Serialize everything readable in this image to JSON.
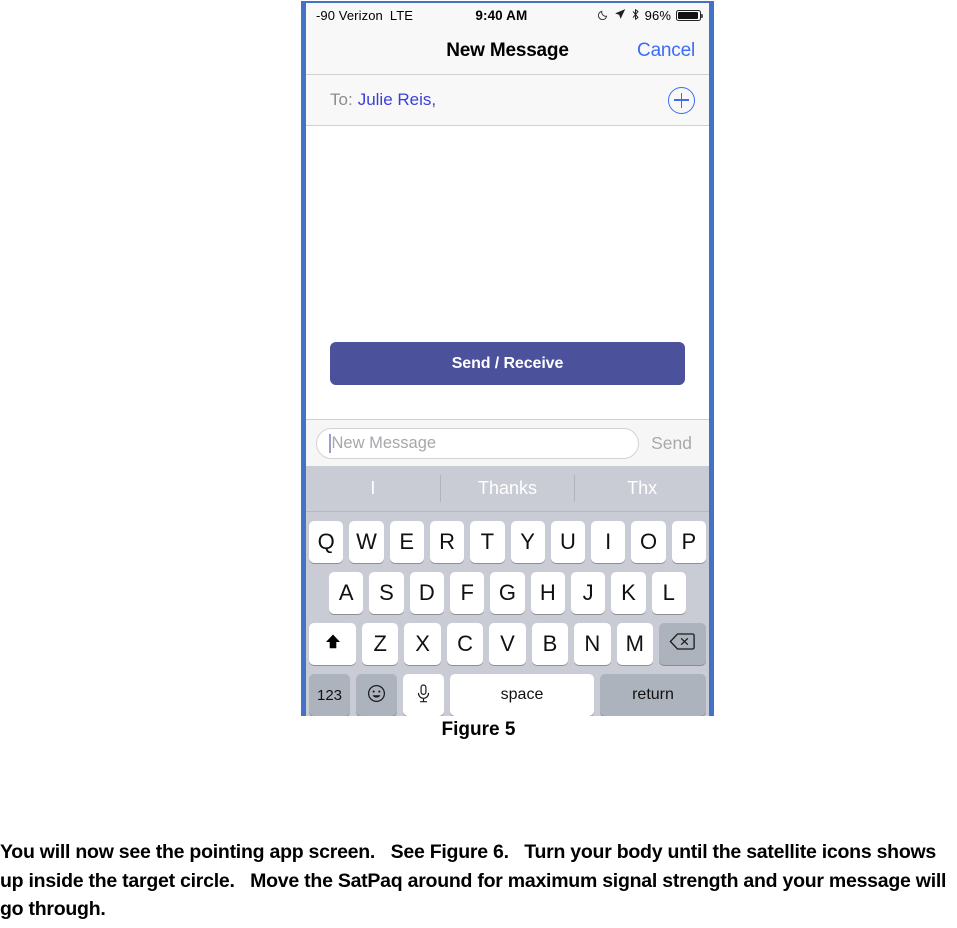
{
  "phone": {
    "status_bar": {
      "signal_text": "-90 Verizon",
      "carrier_network": "LTE",
      "time": "9:40 AM",
      "moon_icon": "moon-icon",
      "location_icon": "location-arrow-icon",
      "bluetooth_icon": "bluetooth-icon",
      "battery_percent": "96%",
      "battery_level": 96
    },
    "nav_bar": {
      "title": "New Message",
      "cancel_label": "Cancel"
    },
    "to_row": {
      "label": "To:",
      "recipients": "Julie Reis,",
      "add_contact_icon": "plus-circle-icon"
    },
    "message_body": {
      "send_receive_label": "Send / Receive"
    },
    "compose_bar": {
      "placeholder": "New Message",
      "value": "",
      "send_label": "Send"
    },
    "keyboard": {
      "predictive": [
        "I",
        "Thanks",
        "Thx"
      ],
      "row1": [
        "Q",
        "W",
        "E",
        "R",
        "T",
        "Y",
        "U",
        "I",
        "O",
        "P"
      ],
      "row2": [
        "A",
        "S",
        "D",
        "F",
        "G",
        "H",
        "J",
        "K",
        "L"
      ],
      "row3": [
        "Z",
        "X",
        "C",
        "V",
        "B",
        "N",
        "M"
      ],
      "shift_key": "⬆",
      "delete_key": "⌫",
      "numeric_key": "123",
      "emoji_key": "☺",
      "mic_key": "🎤",
      "space_key": "space",
      "return_key": "return"
    }
  },
  "figure": {
    "caption": "Figure 5"
  },
  "body_text": {
    "paragraph": "You will now see the pointing app screen.   See Figure 6.   Turn your body until the satellite icons shows up inside the target circle.   Move the SatPaq around for maximum signal strength and your message will go through."
  },
  "colors": {
    "frame_blue": "#4472c4",
    "send_receive_purple": "#4b519b",
    "link_blue": "#3b6df5",
    "recipient_blue": "#3b3fd8",
    "keyboard_bg": "#c9ccd4"
  }
}
